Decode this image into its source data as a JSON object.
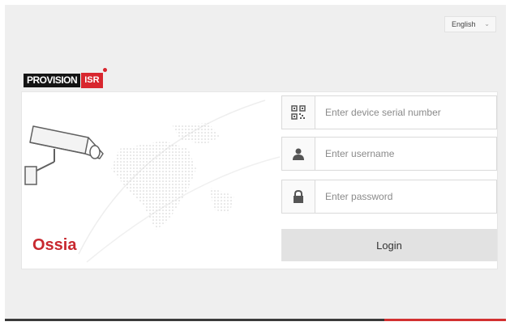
{
  "language": {
    "selected": "English"
  },
  "brand": {
    "wordmark": "PROVISION",
    "badge": "ISR"
  },
  "product": {
    "name": "Ossia"
  },
  "form": {
    "serial_placeholder": "Enter device serial number",
    "username_placeholder": "Enter username",
    "password_placeholder": "Enter password",
    "login_label": "Login"
  },
  "icons": {
    "serial": "qr-code-icon",
    "username": "user-icon",
    "password": "lock-icon"
  },
  "colors": {
    "brand_red": "#c8282f",
    "page_background": "#efefef",
    "login_button": "#e2e2e2"
  }
}
